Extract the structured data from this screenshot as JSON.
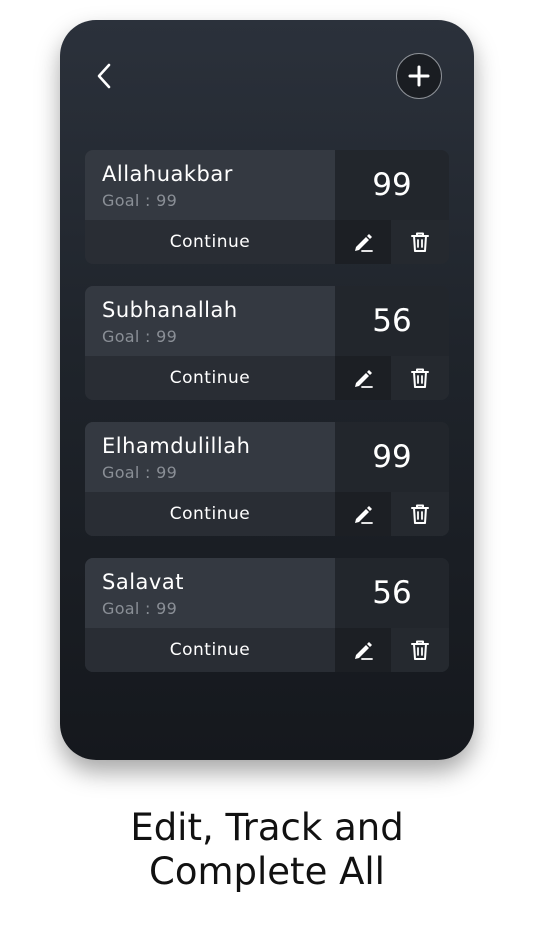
{
  "header": {
    "back_icon": "chevron-left-icon",
    "add_icon": "plus-icon"
  },
  "cards": [
    {
      "title": "Allahuakbar",
      "goal": "Goal : 99",
      "count": "99",
      "continue_label": "Continue",
      "edit_icon": "pencil-icon",
      "delete_icon": "trash-icon"
    },
    {
      "title": "Subhanallah",
      "goal": "Goal : 99",
      "count": "56",
      "continue_label": "Continue",
      "edit_icon": "pencil-icon",
      "delete_icon": "trash-icon"
    },
    {
      "title": "Elhamdulillah",
      "goal": "Goal : 99",
      "count": "99",
      "continue_label": "Continue",
      "edit_icon": "pencil-icon",
      "delete_icon": "trash-icon"
    },
    {
      "title": "Salavat",
      "goal": "Goal : 99",
      "count": "56",
      "continue_label": "Continue",
      "edit_icon": "pencil-icon",
      "delete_icon": "trash-icon"
    }
  ],
  "caption": {
    "line1": "Edit, Track and",
    "line2": "Complete All"
  },
  "colors": {
    "screen_bg": "#1f242b",
    "card_bg": "#343941",
    "text_primary": "#ffffff",
    "text_secondary": "#8a8f96"
  }
}
